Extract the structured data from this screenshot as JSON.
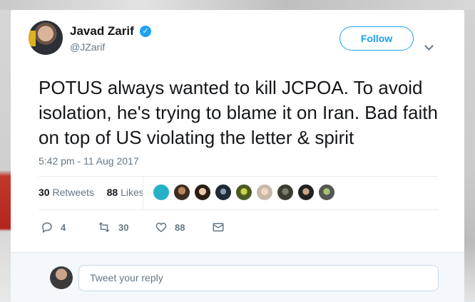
{
  "tweet": {
    "author_name": "Javad Zarif",
    "handle": "@JZarif",
    "follow_label": "Follow",
    "text": "POTUS always wanted to kill JCPOA. To avoid isolation, he's trying to blame it on Iran. Bad faith on top of US violating the letter & spirit",
    "timestamp": "5:42 pm - 11 Aug 2017",
    "retweets_count": "30",
    "retweets_label": "Retweets",
    "likes_count": "88",
    "likes_label": "Likes",
    "replies": "4",
    "retweets": "30",
    "likes": "88"
  },
  "reply_box": {
    "placeholder": "Tweet your reply"
  },
  "colors": {
    "accent": "#1da1f2",
    "muted": "#657786",
    "text": "#14171a"
  },
  "icons": [
    "verified-icon",
    "chevron-down-icon",
    "reply-icon",
    "retweet-icon",
    "like-icon",
    "message-icon"
  ]
}
